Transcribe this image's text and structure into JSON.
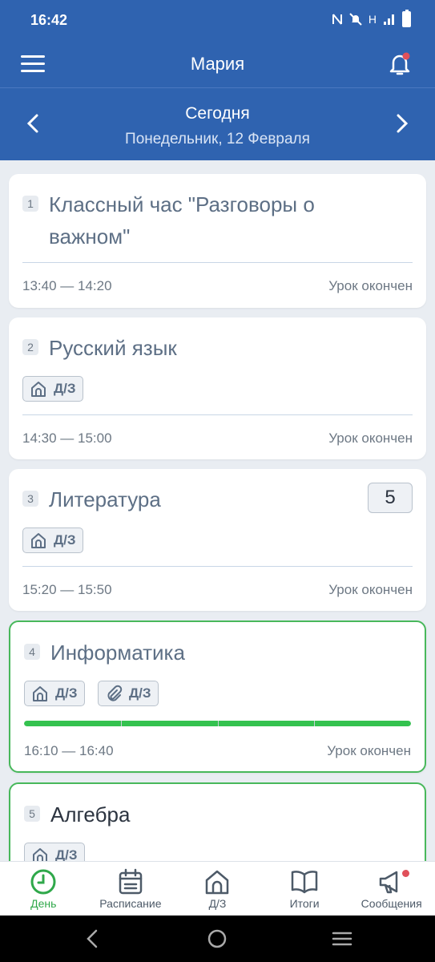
{
  "status_bar": {
    "time": "16:42",
    "network": "H"
  },
  "header": {
    "title": "Мария"
  },
  "date_bar": {
    "day_label": "Сегодня",
    "date": "Понедельник, 12 Февраля"
  },
  "lessons": [
    {
      "number": "1",
      "subject": "Классный час \"Разговоры о",
      "subject_line2": "важном\"",
      "time": "13:40 — 14:20",
      "status": "Урок окончен"
    },
    {
      "number": "2",
      "subject": "Русский язык",
      "hw_label": "Д/З",
      "time": "14:30 — 15:00",
      "status": "Урок окончен"
    },
    {
      "number": "3",
      "subject": "Литература",
      "grade": "5",
      "hw_label": "Д/З",
      "time": "15:20 — 15:50",
      "status": "Урок окончен"
    },
    {
      "number": "4",
      "subject": "Информатика",
      "hw_label": "Д/З",
      "attach_label": "Д/З",
      "progress": 1.0,
      "time": "16:10 — 16:40",
      "status": "Урок окончен"
    },
    {
      "number": "5",
      "subject": "Алгебра",
      "hw_label": "Д/З"
    }
  ],
  "bottom_nav": [
    {
      "label": "День",
      "icon": "clock-icon",
      "active": true
    },
    {
      "label": "Расписание",
      "icon": "calendar-icon"
    },
    {
      "label": "Д/З",
      "icon": "house-icon"
    },
    {
      "label": "Итоги",
      "icon": "book-icon"
    },
    {
      "label": "Сообщения",
      "icon": "megaphone-icon",
      "badge": true
    }
  ],
  "colors": {
    "primary": "#2f63b0",
    "accent_green": "#34c24f",
    "badge_red": "#e0505a"
  }
}
